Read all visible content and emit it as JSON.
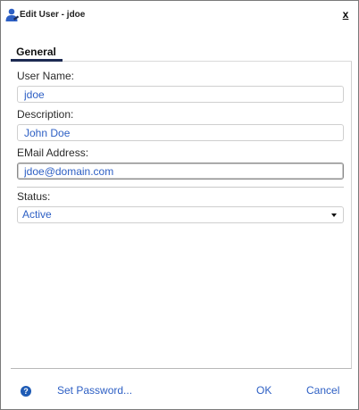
{
  "window": {
    "title": "Edit User - jdoe",
    "title_icon": "user-edit-icon",
    "close_label": "x"
  },
  "tabs": [
    {
      "label": "General",
      "selected": true
    }
  ],
  "form": {
    "user_name": {
      "label": "User Name:",
      "value": "jdoe"
    },
    "description": {
      "label": "Description:",
      "value": "John Doe"
    },
    "email": {
      "label": "EMail Address:",
      "value": "jdoe@domain.com",
      "focused": true
    },
    "status": {
      "label": "Status:",
      "value": "Active",
      "icon": "chevron-down-icon"
    }
  },
  "footer": {
    "help_icon": "help-icon",
    "help_glyph": "?",
    "set_password_label": "Set Password...",
    "ok_label": "OK",
    "cancel_label": "Cancel"
  },
  "colors": {
    "value_text": "#2d5fc4",
    "tab_underline": "#1c2a52",
    "help_button": "#1e5bb5"
  }
}
